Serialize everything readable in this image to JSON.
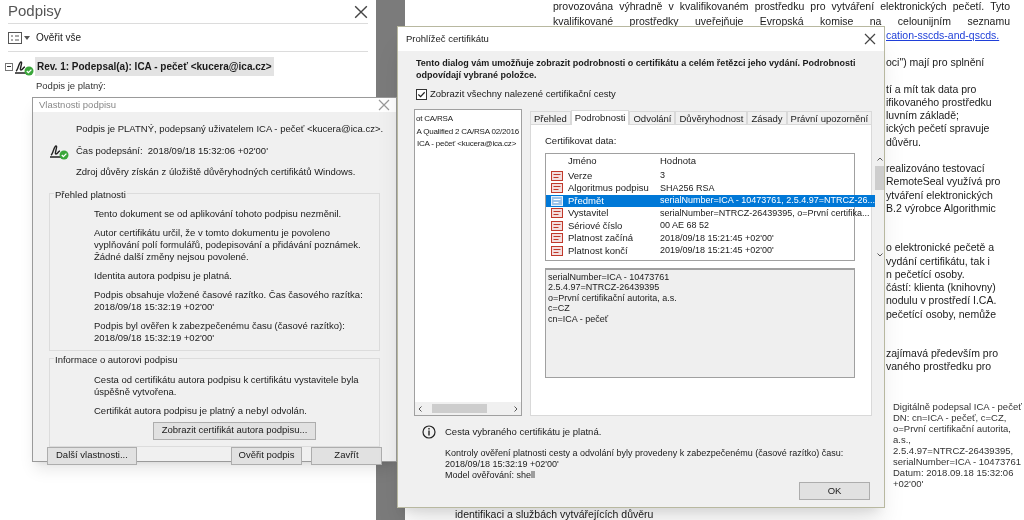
{
  "signatures_panel": {
    "title": "Podpisy",
    "toolbar_label": "Ověřit vše",
    "signature_item": {
      "label": "Rev. 1: Podepsal(a): ICA - pečeť <kucera@ica.cz>",
      "selected": true,
      "expanded": true
    },
    "status_text": "Podpis je platný:"
  },
  "document": {
    "top_lines": [
      "provozována výhradně v kvalifikovaném prostředku pro vytváření elektronických pečetí. Tyto",
      "kvalifikované prostředky uveřejňuje Evropská komise na celounijním seznamu"
    ],
    "link": "cation-sscds-and-qscds.",
    "paragraphs": [
      [
        "oci\") mají pro splnění"
      ],
      [
        "tí a mít tak data pro",
        "ifikovaného prostředku",
        "luvním základě;",
        "ických pečetí spravuje",
        "důvěru."
      ],
      [
        "realizováno testovací",
        "RemoteSeal využívá pro",
        "ytváření elektronických",
        "B.2 výrobce Algorithmic"
      ],
      [
        "o elektronické pečetě a",
        "vydání certifikátu, tak i",
        "n pečetící osoby.",
        "částí: klienta (knihovny)",
        "nodulu v prostředí I.CA.",
        "pečetící osoby, nemůže"
      ],
      [
        "zajímavá především pro",
        "vaného prostředku pro"
      ]
    ],
    "signature_stamp": [
      "Digitálně podepsal ICA - pečeť",
      "DN: cn=ICA - pečeť, c=CZ,",
      "o=První certifikační autorita,",
      "a.s.,",
      "2.5.4.97=NTRCZ-26439395,",
      "serialNumber=ICA - 10473761",
      "Datum: 2018.09.18 15:32:06",
      "+02'00'"
    ],
    "bottom_line": "identifikaci a službách vytvářejících důvěru"
  },
  "properties_dialog": {
    "title": "Vlastnosti podpisu",
    "summary": [
      "Podpis je PLATNÝ, podepsaný uživatelem ICA - pečeť <kucera@ica.cz>.",
      "Čas podepsání:  2018/09/18 15:32:06 +02'00'",
      "Zdroj důvěry získán z úložiště důvěryhodných certifikátů Windows."
    ],
    "groups": [
      {
        "title": "Přehled platnosti",
        "items": [
          "Tento dokument se od aplikování tohoto podpisu nezměnil.",
          "Autor certifikátu určil, že v tomto dokumentu je povoleno vyplňování polí formulářů, podepisování a přidávání poznámek. Žádné další změny nejsou povolené.",
          "Identita autora podpisu je platná.",
          "Podpis obsahuje vložené časové razítko. Čas časového razítka:\n2018/09/18 15:32:19 +02'00'",
          "Podpis byl ověřen k zabezpečenému času (časové razítko):\n2018/09/18 15:32:19 +02'00'"
        ]
      },
      {
        "title": "Informace o autorovi podpisu",
        "items": [
          "Cesta od certifikátu autora podpisu k certifikátu vystavitele byla úspěšně vytvořena.",
          "Certifikát autora podpisu je platný a nebyl odvolán."
        ],
        "button": "Zobrazit certifikát autora podpisu..."
      }
    ],
    "buttons": [
      "Další vlastnosti...",
      "Ověřit podpis",
      "Zavřít"
    ]
  },
  "certificate_viewer": {
    "title": "Prohlížeč certifikátu",
    "description": "Tento dialog vám umožňuje zobrazit podrobnosti o certifikátu a celém řetězci jeho vydání. Podrobnosti odpovídají vybrané položce.",
    "show_all_paths": {
      "label": "Zobrazit všechny nalezené certifikační cesty",
      "checked": true
    },
    "chain": [
      {
        "label": "ot CA/RSA",
        "children": [
          {
            "label": "A Qualified 2 CA/RSA 02/2016",
            "children": [
              {
                "label": "ICA - pečeť <kucera@ica.cz>"
              }
            ]
          }
        ]
      }
    ],
    "tabs": [
      {
        "label": "Přehled",
        "selected": false
      },
      {
        "label": "Podrobnosti",
        "selected": true
      },
      {
        "label": "Odvolání",
        "selected": false
      },
      {
        "label": "Důvěryhodnost",
        "selected": false
      },
      {
        "label": "Zásady",
        "selected": false
      },
      {
        "label": "Právní upozornění",
        "selected": false
      }
    ],
    "data_label": "Certifikovat data:",
    "columns": [
      "Jméno",
      "Hodnota"
    ],
    "fields": [
      {
        "name": "Verze",
        "value": "3",
        "selected": false
      },
      {
        "name": "Algoritmus podpisu",
        "value": "SHA256 RSA",
        "selected": false
      },
      {
        "name": "Předmět",
        "value": "serialNumber=ICA - 10473761, 2.5.4.97=NTRCZ-26...",
        "selected": true
      },
      {
        "name": "Vystavitel",
        "value": "serialNumber=NTRCZ-26439395, o=První certifika...",
        "selected": false
      },
      {
        "name": "Sériové číslo",
        "value": "00 AE 68 52",
        "selected": false
      },
      {
        "name": "Platnost začíná",
        "value": "2018/09/18 15:21:45 +02'00'",
        "selected": false
      },
      {
        "name": "Platnost končí",
        "value": "2019/09/18 15:21:45 +02'00'",
        "selected": false
      }
    ],
    "detail_lines": [
      "serialNumber=ICA - 10473761",
      "2.5.4.97=NTRCZ-26439395",
      "o=První certifikační autorita, a.s.",
      "c=CZ",
      "cn=ICA - pečeť"
    ],
    "status": "Cesta vybraného certifikátu je platná.",
    "notes": [
      "Kontroly ověření platnosti cesty a odvolání byly provedeny k zabezpečenému (časové razítko) času:",
      "2018/09/18 15:32:19 +02'00'",
      "Model ověřování: shell"
    ],
    "ok_button": "OK"
  }
}
